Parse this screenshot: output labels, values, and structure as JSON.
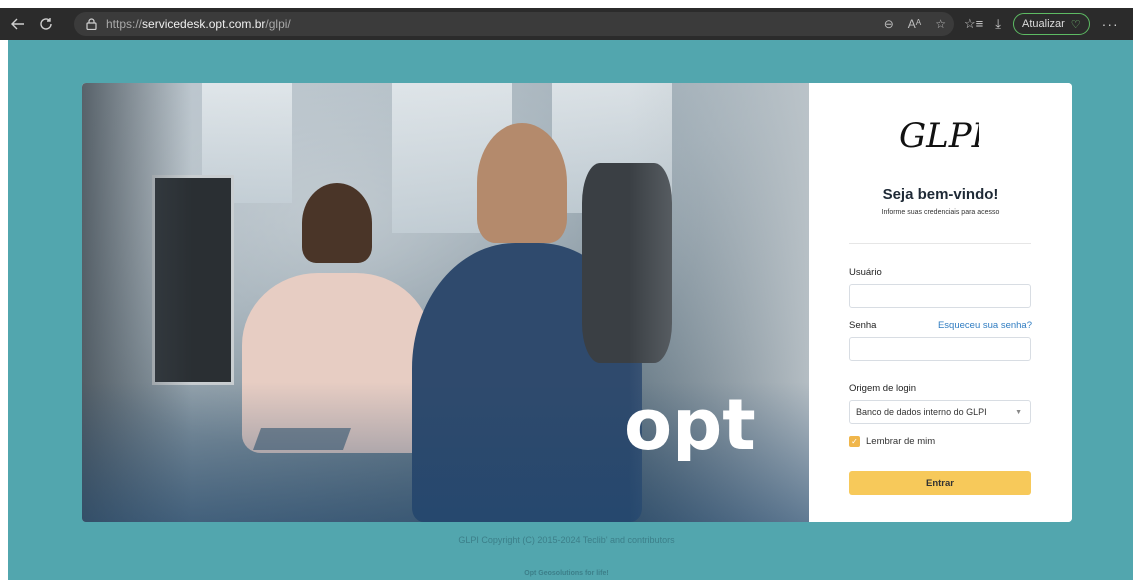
{
  "browser": {
    "url_prefix": "https://",
    "url_host": "servicedesk.opt.com.br",
    "url_path": "/glpi/",
    "update_label": "Atualizar",
    "zoom_icon": "zoom-icon",
    "read_aloud_icon": "read-aloud-icon",
    "favorite_icon": "star-icon"
  },
  "hero": {
    "logo_text": "opt"
  },
  "login": {
    "logo_text": "GLPI",
    "welcome": "Seja bem-vindo!",
    "subtitle": "Informe suas credenciais para acesso",
    "username_label": "Usuário",
    "username_value": "",
    "password_label": "Senha",
    "password_value": "",
    "forgot_password": "Esqueceu sua senha?",
    "origin_label": "Origem de login",
    "origin_value": "Banco de dados interno do GLPI",
    "remember_label": "Lembrar de mim",
    "remember_checked": true,
    "submit_label": "Entrar"
  },
  "footer": {
    "copyright": "GLPI Copyright (C) 2015-2024 Teclib' and contributors",
    "tagline": "Opt Geosolutions for life!"
  },
  "colors": {
    "page_bg": "#52a6ae",
    "accent_button": "#f7c95a",
    "link": "#2f7cc1"
  }
}
